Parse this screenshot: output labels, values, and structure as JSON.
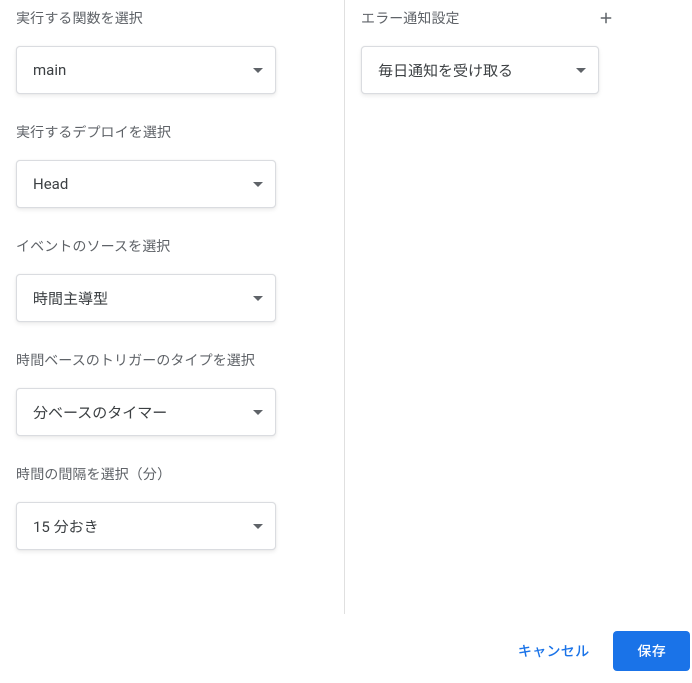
{
  "left": {
    "function_label": "実行する関数を選択",
    "function_value": "main",
    "deploy_label": "実行するデプロイを選択",
    "deploy_value": "Head",
    "event_source_label": "イベントのソースを選択",
    "event_source_value": "時間主導型",
    "trigger_type_label": "時間ベースのトリガーのタイプを選択",
    "trigger_type_value": "分ベースのタイマー",
    "interval_label": "時間の間隔を選択（分）",
    "interval_value": "15 分おき"
  },
  "right": {
    "error_notify_label": "エラー通知設定",
    "error_notify_value": "毎日通知を受け取る"
  },
  "footer": {
    "cancel": "キャンセル",
    "save": "保存"
  }
}
